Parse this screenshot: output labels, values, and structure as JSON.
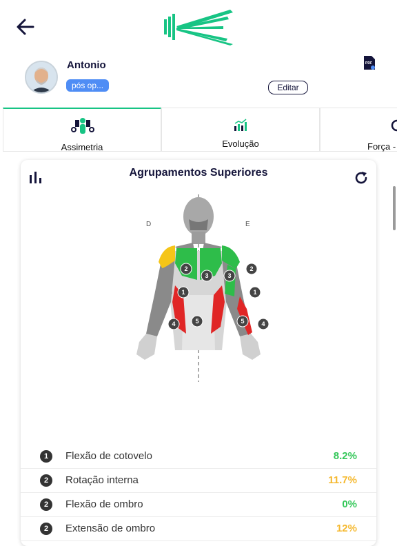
{
  "header": {
    "patient_name": "Antonio",
    "status_badge": "pós op...",
    "edit_label": "Editar",
    "pdf_icon": "pdf-icon",
    "accent": "#17c484"
  },
  "tabs": [
    {
      "label": "Assimetria",
      "active": true
    },
    {
      "label": "Evolução",
      "active": false
    },
    {
      "label": "Força -",
      "active": false
    }
  ],
  "card": {
    "title": "Agrupamentos  Superiores",
    "side_right": "D",
    "side_left": "E"
  },
  "body_markers": [
    "1",
    "2",
    "3",
    "4",
    "5"
  ],
  "list": [
    {
      "num": "1",
      "label": "Flexão de cotovelo",
      "value": "8.2%",
      "color": "#34c759"
    },
    {
      "num": "2",
      "label": "Rotação interna",
      "value": "11.7%",
      "color": "#f5b82e"
    },
    {
      "num": "2",
      "label": "Flexão de ombro",
      "value": "0%",
      "color": "#34c759"
    },
    {
      "num": "2",
      "label": "Extensão de ombro",
      "value": "12%",
      "color": "#f5b82e"
    }
  ]
}
